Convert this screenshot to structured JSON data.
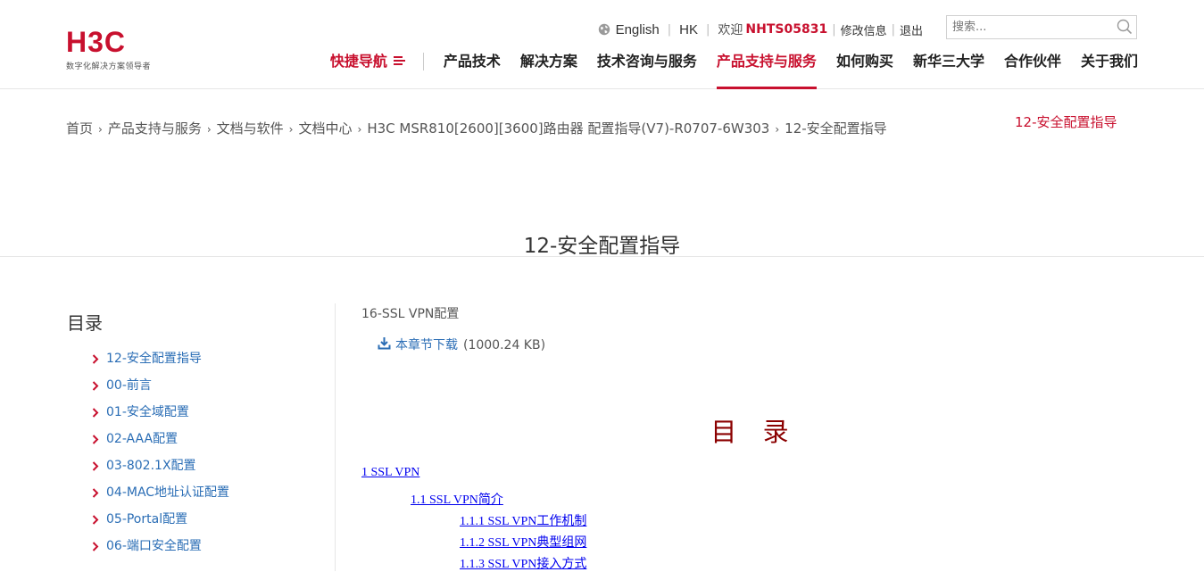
{
  "brand": {
    "logo_text": "H3C",
    "slogan": "数字化解决方案领导者",
    "colors": {
      "accent": "#c8102e",
      "link": "#2a6db5",
      "doc_link": "#0000ee",
      "doc_heading": "#8b0000"
    }
  },
  "topbar": {
    "language": "English",
    "region": "HK",
    "welcome": "欢迎",
    "username": "NHTS05831",
    "sep": "|",
    "edit_info": "修改信息",
    "logout": "退出"
  },
  "search": {
    "placeholder": "搜索...",
    "icon": "search-icon"
  },
  "nav": {
    "quick": "快捷导航",
    "items": [
      "产品技术",
      "解决方案",
      "技术咨询与服务",
      "产品支持与服务",
      "如何购买",
      "新华三大学",
      "合作伙伴",
      "关于我们"
    ],
    "active_index": 3
  },
  "breadcrumb": {
    "items": [
      "首页",
      "产品支持与服务",
      "文档与软件",
      "文档中心",
      "H3C MSR810[2600][3600]路由器 配置指导(V7)-R0707-6W303",
      "12-安全配置指导"
    ],
    "sep": "›"
  },
  "side_title": "12-安全配置指导",
  "page_title": "12-安全配置指导",
  "sidebar": {
    "heading": "目录",
    "items": [
      "12-安全配置指导",
      "00-前言",
      "01-安全域配置",
      "02-AAA配置",
      "03-802.1X配置",
      "04-MAC地址认证配置",
      "05-Portal配置",
      "06-端口安全配置"
    ]
  },
  "content": {
    "chapter": "16-SSL VPN配置",
    "download_label": "本章节下载",
    "download_size": "(1000.24 KB)",
    "doc_heading": "目 录",
    "toc": [
      "1 SSL VPN",
      "1.1 SSL VPN简介",
      "1.1.1 SSL VPN工作机制",
      "1.1.2 SSL VPN典型组网",
      "1.1.3 SSL VPN接入方式"
    ]
  }
}
